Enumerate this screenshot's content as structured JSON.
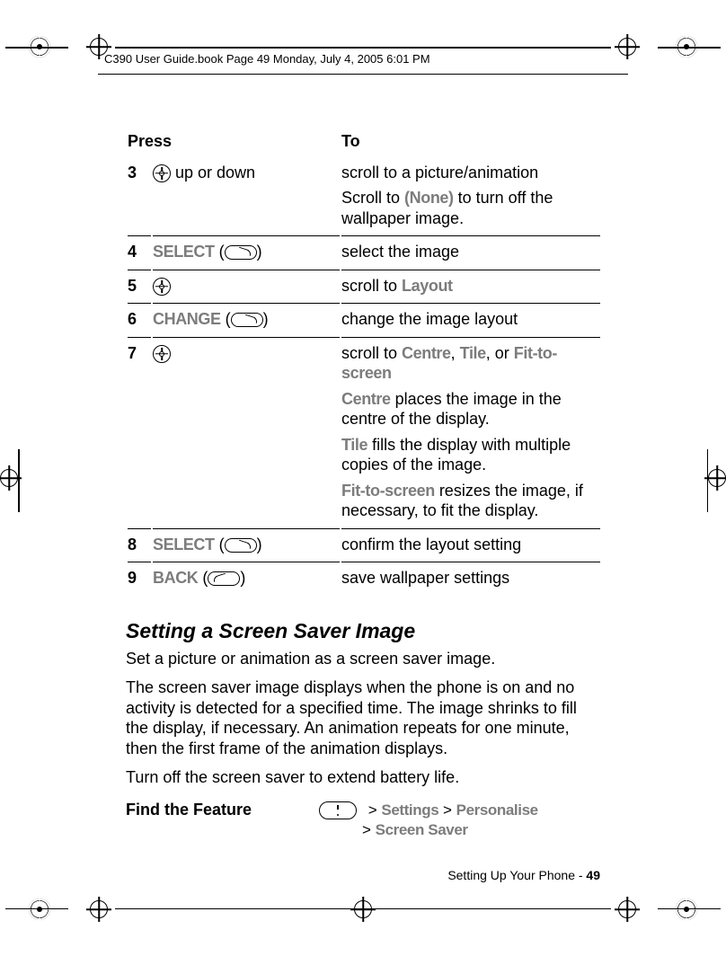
{
  "meta": {
    "filename_line": "C390 User Guide.book  Page 49  Monday, July 4, 2005  6:01 PM"
  },
  "table": {
    "header_press": "Press",
    "header_to": "To",
    "rows": {
      "r3": {
        "num": "3",
        "press_suffix": " up or down",
        "to_a": "scroll to a picture/animation",
        "to_b_pre": "Scroll to ",
        "to_b_ui": "(None)",
        "to_b_post": " to turn off the wallpaper image."
      },
      "r4": {
        "num": "4",
        "press_ui": "SELECT",
        "to": "select the image"
      },
      "r5": {
        "num": "5",
        "to_pre": "scroll to ",
        "to_ui": "Layout"
      },
      "r6": {
        "num": "6",
        "press_ui": "CHANGE",
        "to": "change the image layout"
      },
      "r7": {
        "num": "7",
        "to_line1_pre": "scroll to ",
        "to_line1_a": "Centre",
        "to_line1_sep1": ", ",
        "to_line1_b": "Tile",
        "to_line1_sep2": ", or ",
        "to_line1_c": "Fit-to-screen",
        "to_p2_ui": "Centre",
        "to_p2_txt": " places the image in the centre of the display.",
        "to_p3_ui": "Tile",
        "to_p3_txt": " fills the display with multiple copies of the image.",
        "to_p4_ui": "Fit-to-screen",
        "to_p4_txt": " resizes the image, if necessary, to fit the display."
      },
      "r8": {
        "num": "8",
        "press_ui": "SELECT",
        "to": "confirm the layout setting"
      },
      "r9": {
        "num": "9",
        "press_ui": "BACK",
        "to": "save wallpaper settings"
      }
    }
  },
  "section": {
    "heading": "Setting a Screen Saver Image",
    "p1": "Set a picture or animation as a screen saver image.",
    "p2": "The screen saver image displays when the phone is on and no activity is detected for a specified time. The image shrinks to fill the display, if necessary. An animation repeats for one minute, then the first frame of the animation displays.",
    "p3": "Turn off the screen saver to extend battery life."
  },
  "find": {
    "label": "Find the Feature",
    "gt1": "> ",
    "s1": "Settings",
    "sep1": " > ",
    "s2": "Personalise",
    "gt2": "> ",
    "s3": "Screen Saver"
  },
  "footer": {
    "text": "Setting Up Your Phone - ",
    "page": "49"
  }
}
